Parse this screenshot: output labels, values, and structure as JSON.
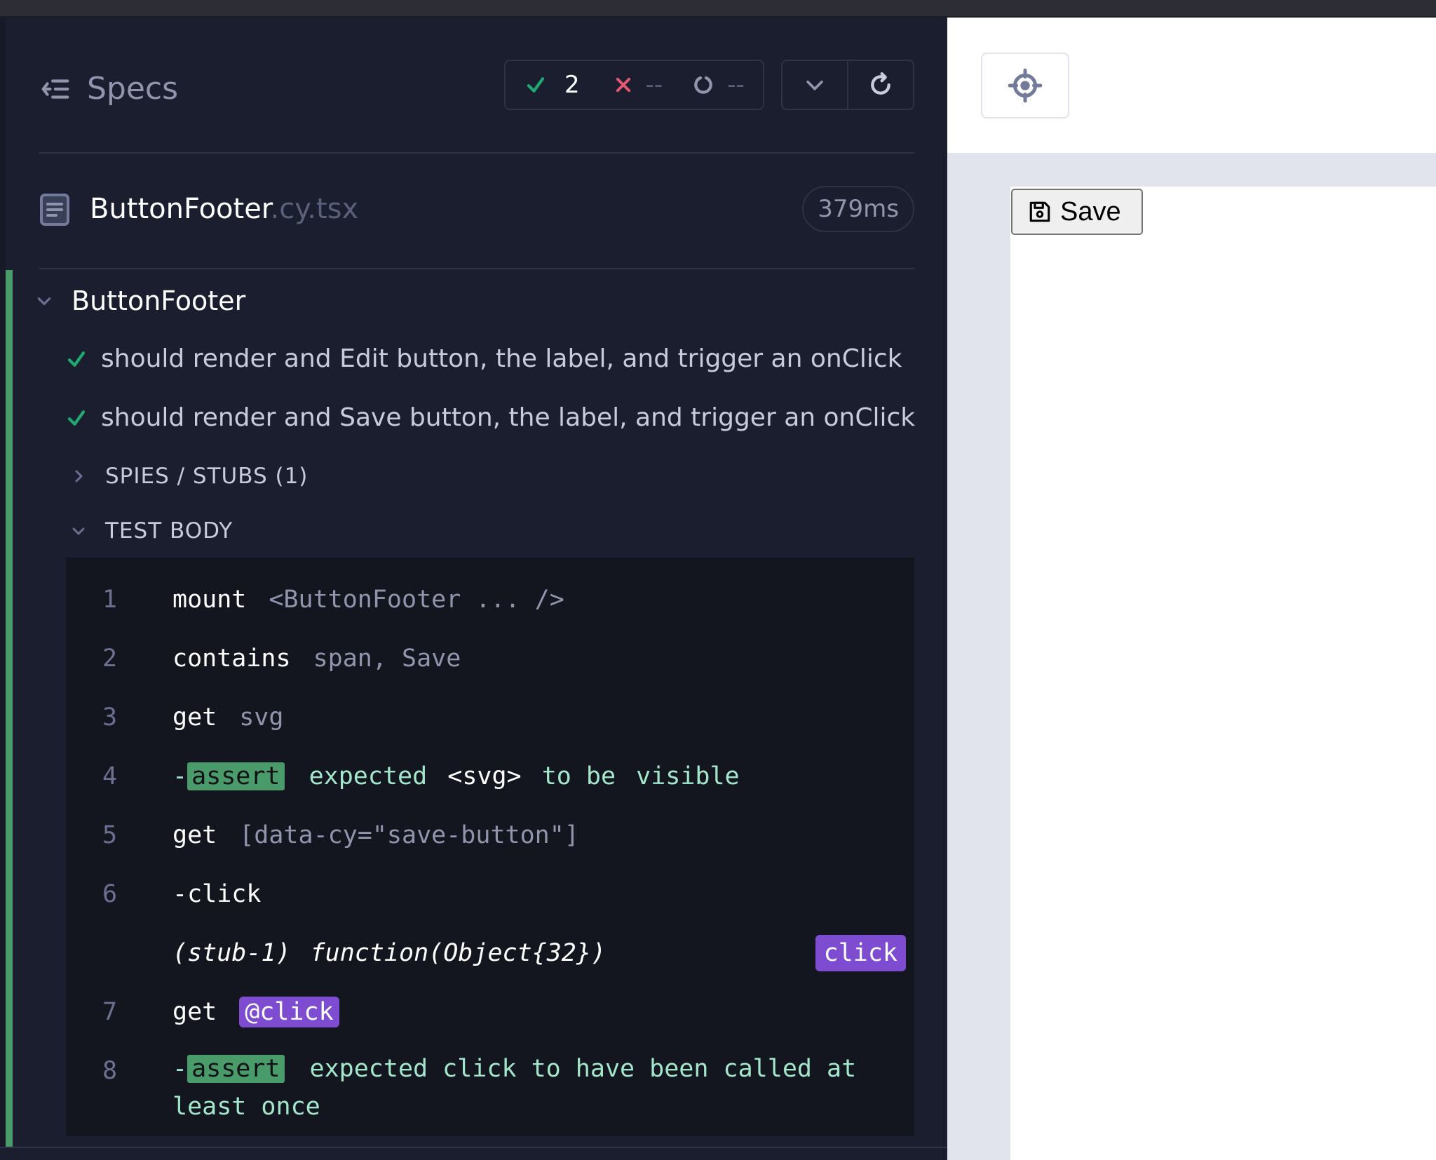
{
  "header": {
    "specs_label": "Specs",
    "passed": "2",
    "failed": "--",
    "pending": "--"
  },
  "file": {
    "name": "ButtonFooter",
    "ext": ".cy.tsx",
    "duration": "379ms"
  },
  "suite": {
    "title": "ButtonFooter",
    "tests": [
      "should render and Edit button, the label, and trigger an onClick",
      "should render and Save button, the label, and trigger an onClick"
    ],
    "spies_label": "SPIES / STUBS (1)",
    "body_label": "TEST BODY"
  },
  "commands": {
    "c1": {
      "num": "1",
      "name": "mount",
      "msg": "<ButtonFooter ... />"
    },
    "c2": {
      "num": "2",
      "name": "contains",
      "msg": "span, Save"
    },
    "c3": {
      "num": "3",
      "name": "get",
      "msg": "svg"
    },
    "c4": {
      "num": "4",
      "dash": "-",
      "badge": "assert",
      "w1": "expected",
      "w2": "<svg>",
      "w3": "to be",
      "w4": "visible"
    },
    "c5": {
      "num": "5",
      "name": "get",
      "msg": "[data-cy=\"save-button\"]"
    },
    "c6": {
      "num": "6",
      "name": "-click"
    },
    "c6_event": {
      "stub": "(stub-1)",
      "fn": "function(Object{32})",
      "badge": "click"
    },
    "c7": {
      "num": "7",
      "name": "get",
      "alias": "@click"
    },
    "c8": {
      "num": "8",
      "dash": "-",
      "badge": "assert",
      "line1": "expected click to have been called at",
      "line2": "least once"
    }
  },
  "aut": {
    "save_button_label": "Save"
  },
  "colors": {
    "pass": "#1fa971",
    "fail": "#e45770",
    "accent_purple": "#7d4cd1"
  }
}
